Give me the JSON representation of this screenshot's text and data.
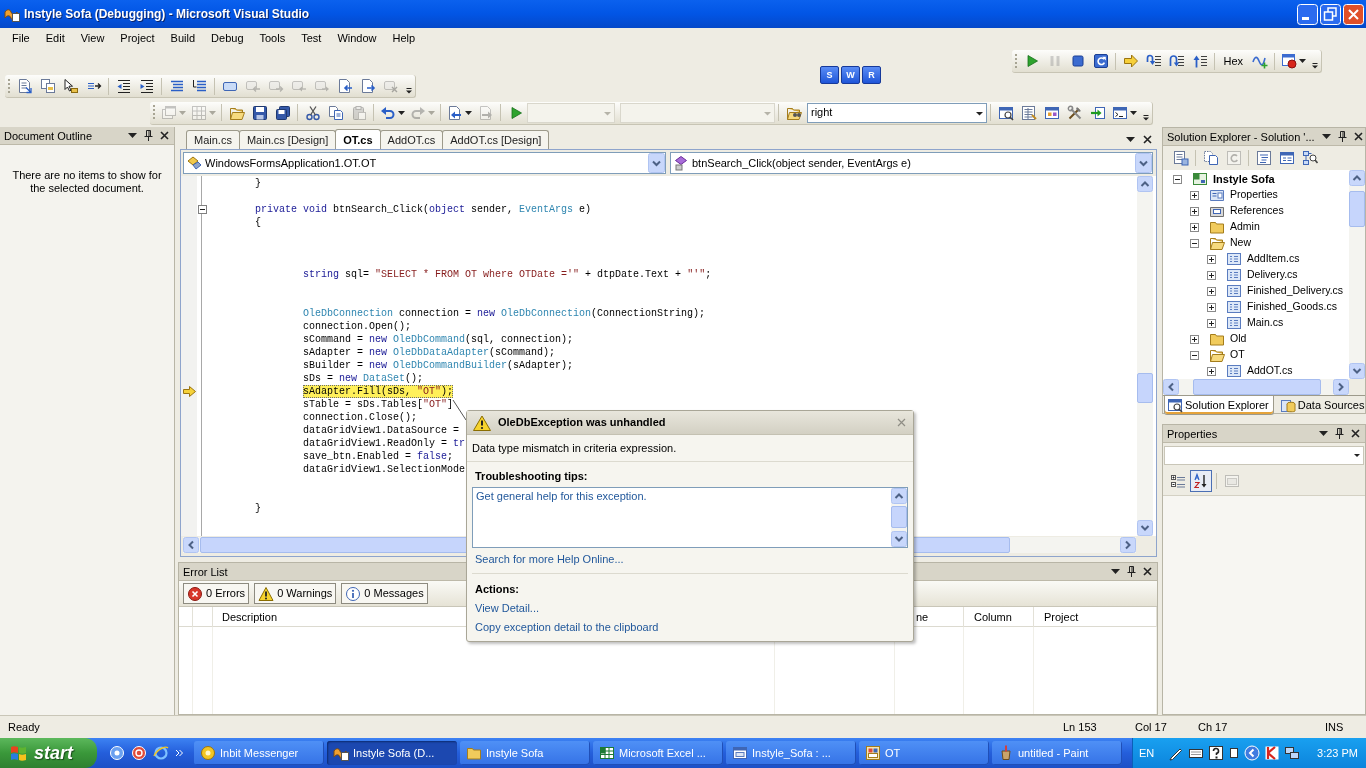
{
  "window": {
    "title": "Instyle Sofa (Debugging) - Microsoft Visual Studio"
  },
  "menu": [
    "File",
    "Edit",
    "View",
    "Project",
    "Build",
    "Debug",
    "Tools",
    "Test",
    "Window",
    "Help"
  ],
  "toolbars": {
    "debug": [
      {
        "kind": "button",
        "disabled": false
      },
      {
        "kind": "button",
        "disabled": true
      },
      {
        "kind": "button",
        "disabled": false
      },
      {
        "kind": "button",
        "disabled": false
      },
      {
        "kind": "button",
        "disabled": false
      },
      {
        "kind": "button",
        "disabled": false
      },
      {
        "kind": "button",
        "disabled": false
      },
      {
        "kind": "button",
        "disabled": false
      },
      {
        "kind": "text",
        "label": "Hex",
        "disabled": false
      },
      {
        "kind": "button",
        "disabled": false
      },
      {
        "kind": "split",
        "disabled": false
      }
    ],
    "text_editor": [
      {
        "kind": "button",
        "disabled": false
      },
      {
        "kind": "button",
        "disabled": false
      },
      {
        "kind": "button",
        "disabled": false
      },
      {
        "kind": "button",
        "disabled": false
      },
      {
        "kind": "button",
        "disabled": false
      },
      {
        "kind": "button",
        "disabled": false
      },
      {
        "kind": "button",
        "disabled": false
      },
      {
        "kind": "button",
        "disabled": false
      },
      {
        "kind": "button",
        "disabled": false
      },
      {
        "kind": "button",
        "disabled": true
      },
      {
        "kind": "button",
        "disabled": true
      },
      {
        "kind": "button",
        "disabled": true
      },
      {
        "kind": "button",
        "disabled": true
      },
      {
        "kind": "button",
        "disabled": false
      },
      {
        "kind": "button",
        "disabled": false
      },
      {
        "kind": "button",
        "disabled": true
      }
    ],
    "standard": [
      {
        "kind": "split",
        "disabled": true
      },
      {
        "kind": "split",
        "disabled": true
      },
      {
        "kind": "button",
        "disabled": false
      },
      {
        "kind": "button",
        "disabled": false
      },
      {
        "kind": "button",
        "disabled": false
      },
      {
        "kind": "button",
        "disabled": false
      },
      {
        "kind": "button",
        "disabled": false
      },
      {
        "kind": "button",
        "disabled": true
      },
      {
        "kind": "split",
        "disabled": false
      },
      {
        "kind": "split",
        "disabled": true
      },
      {
        "kind": "split",
        "disabled": false
      },
      {
        "kind": "button",
        "disabled": true
      },
      {
        "kind": "button",
        "disabled": false
      },
      {
        "kind": "combo",
        "disabled": true
      },
      {
        "kind": "combo",
        "disabled": true
      },
      {
        "kind": "button",
        "disabled": false
      },
      {
        "kind": "combo",
        "value": "right",
        "disabled": false
      },
      {
        "kind": "button",
        "disabled": false
      },
      {
        "kind": "button",
        "disabled": false
      },
      {
        "kind": "button",
        "disabled": false
      },
      {
        "kind": "button",
        "disabled": false
      },
      {
        "kind": "button",
        "disabled": false
      },
      {
        "kind": "split",
        "disabled": false
      }
    ]
  },
  "floating_toolbar": [
    "S",
    "W",
    "R"
  ],
  "document_outline": {
    "title": "Document Outline",
    "message": "There are no items to show for the selected document."
  },
  "editor": {
    "tabs": [
      {
        "label": "Main.cs",
        "selected": false
      },
      {
        "label": "Main.cs [Design]",
        "selected": false
      },
      {
        "label": "OT.cs",
        "selected": true
      },
      {
        "label": "AddOT.cs",
        "selected": false
      },
      {
        "label": "AddOT.cs [Design]",
        "selected": false
      }
    ],
    "type_combo": "WindowsFormsApplication1.OT.OT",
    "member_combo": "btnSearch_Click(object sender, EventArgs e)",
    "lines": [
      {
        "kind": "code",
        "current": false,
        "tokens": [
          {
            "kind": "plain",
            "text": "        }"
          }
        ]
      },
      {
        "kind": "blank"
      },
      {
        "kind": "header",
        "current": false,
        "tokens": [
          {
            "kind": "keyword",
            "text": "        private void"
          },
          {
            "kind": "plain",
            "text": " btnSearch_Click("
          },
          {
            "kind": "keyword",
            "text": "object"
          },
          {
            "kind": "plain",
            "text": " sender, "
          },
          {
            "kind": "type",
            "text": "EventArgs"
          },
          {
            "kind": "plain",
            "text": " e)"
          }
        ]
      },
      {
        "kind": "code",
        "current": false,
        "tokens": [
          {
            "kind": "plain",
            "text": "        {"
          }
        ]
      },
      {
        "kind": "blank"
      },
      {
        "kind": "blank"
      },
      {
        "kind": "blank"
      },
      {
        "kind": "code",
        "current": false,
        "tokens": [
          {
            "kind": "keyword",
            "text": "                string"
          },
          {
            "kind": "plain",
            "text": " sql= "
          },
          {
            "kind": "string",
            "text": "\"SELECT * FROM OT where OTDate ='\""
          },
          {
            "kind": "plain",
            "text": " + dtpDate.Text + "
          },
          {
            "kind": "string",
            "text": "\"'\""
          },
          {
            "kind": "plain",
            "text": ";"
          }
        ]
      },
      {
        "kind": "blank"
      },
      {
        "kind": "blank"
      },
      {
        "kind": "code",
        "current": false,
        "tokens": [
          {
            "kind": "type",
            "text": "                OleDbConnection"
          },
          {
            "kind": "plain",
            "text": " connection = "
          },
          {
            "kind": "keyword",
            "text": "new"
          },
          {
            "kind": "type",
            "text": " OleDbConnection"
          },
          {
            "kind": "plain",
            "text": "(ConnectionString);"
          }
        ]
      },
      {
        "kind": "code",
        "current": false,
        "tokens": [
          {
            "kind": "plain",
            "text": "                connection.Open();"
          }
        ]
      },
      {
        "kind": "code",
        "current": false,
        "tokens": [
          {
            "kind": "plain",
            "text": "                sCommand = "
          },
          {
            "kind": "keyword",
            "text": "new"
          },
          {
            "kind": "type",
            "text": " OleDbCommand"
          },
          {
            "kind": "plain",
            "text": "(sql, connection);"
          }
        ]
      },
      {
        "kind": "code",
        "current": false,
        "tokens": [
          {
            "kind": "plain",
            "text": "                sAdapter = "
          },
          {
            "kind": "keyword",
            "text": "new"
          },
          {
            "kind": "type",
            "text": " OleDbDataAdapter"
          },
          {
            "kind": "plain",
            "text": "(sCommand);"
          }
        ]
      },
      {
        "kind": "code",
        "current": false,
        "tokens": [
          {
            "kind": "plain",
            "text": "                sBuilder = "
          },
          {
            "kind": "keyword",
            "text": "new"
          },
          {
            "kind": "type",
            "text": " OleDbCommandBuilder"
          },
          {
            "kind": "plain",
            "text": "(sAdapter);"
          }
        ]
      },
      {
        "kind": "code",
        "current": false,
        "tokens": [
          {
            "kind": "plain",
            "text": "                sDs = "
          },
          {
            "kind": "keyword",
            "text": "new"
          },
          {
            "kind": "type",
            "text": " DataSet"
          },
          {
            "kind": "plain",
            "text": "();"
          }
        ]
      },
      {
        "kind": "code",
        "current": true,
        "tokens": [
          {
            "kind": "plain",
            "text": "                sAdapter.Fill(sDs, "
          },
          {
            "kind": "string",
            "text": "\"OT\""
          },
          {
            "kind": "plain",
            "text": ");"
          }
        ]
      },
      {
        "kind": "code",
        "current": false,
        "tokens": [
          {
            "kind": "plain",
            "text": "                sTable = sDs.Tables["
          },
          {
            "kind": "string",
            "text": "\"OT\""
          },
          {
            "kind": "plain",
            "text": "]"
          }
        ]
      },
      {
        "kind": "code",
        "current": false,
        "tokens": [
          {
            "kind": "plain",
            "text": "                connection.Close();"
          }
        ]
      },
      {
        "kind": "code",
        "current": false,
        "tokens": [
          {
            "kind": "plain",
            "text": "                dataGridView1.DataSource ="
          }
        ]
      },
      {
        "kind": "code",
        "current": false,
        "tokens": [
          {
            "kind": "plain",
            "text": "                dataGridView1.ReadOnly = "
          },
          {
            "kind": "keyword",
            "text": "tr"
          }
        ]
      },
      {
        "kind": "code",
        "current": false,
        "tokens": [
          {
            "kind": "plain",
            "text": "                save_btn.Enabled = "
          },
          {
            "kind": "keyword",
            "text": "false"
          },
          {
            "kind": "plain",
            "text": ";"
          }
        ]
      },
      {
        "kind": "code",
        "current": false,
        "tokens": [
          {
            "kind": "plain",
            "text": "                dataGridView1.SelectionMode"
          }
        ]
      },
      {
        "kind": "blank"
      },
      {
        "kind": "blank"
      },
      {
        "kind": "code",
        "current": false,
        "tokens": [
          {
            "kind": "plain",
            "text": "        }"
          }
        ]
      }
    ]
  },
  "exception_assistant": {
    "title": "OleDbException was unhandled",
    "message": "Data type mismatch in criteria expression.",
    "tips_heading": "Troubleshooting tips:",
    "tips": [
      "Get general help for this exception."
    ],
    "help_link": "Search for more Help Online...",
    "actions_heading": "Actions:",
    "actions": [
      "View Detail...",
      "Copy exception detail to the clipboard"
    ]
  },
  "error_list": {
    "title": "Error List",
    "filters": [
      {
        "kind": "error",
        "label": "0 Errors",
        "selected": true
      },
      {
        "kind": "warning",
        "label": "0 Warnings",
        "selected": true
      },
      {
        "kind": "message",
        "label": "0 Messages",
        "selected": true
      }
    ],
    "columns": [
      "Description",
      "ne",
      "Column",
      "Project"
    ]
  },
  "solution_explorer": {
    "title": "Solution Explorer - Solution '...",
    "toolbar": [
      {
        "disabled": false
      },
      {
        "disabled": false
      },
      {
        "disabled": true
      },
      {
        "disabled": false
      },
      {
        "disabled": false
      },
      {
        "disabled": false
      }
    ],
    "tree": [
      {
        "label": "Instyle Sofa",
        "kind": "project",
        "expanded": true,
        "children": [
          {
            "label": "Properties",
            "kind": "properties",
            "expanded": false
          },
          {
            "label": "References",
            "kind": "references",
            "expanded": false
          },
          {
            "label": "Admin",
            "kind": "folder",
            "expanded": false
          },
          {
            "label": "New",
            "kind": "folder",
            "expanded": true,
            "children": [
              {
                "label": "AddItem.cs",
                "kind": "file",
                "expanded": false
              },
              {
                "label": "Delivery.cs",
                "kind": "file",
                "expanded": false
              },
              {
                "label": "Finished_Delivery.cs",
                "kind": "file",
                "expanded": false
              },
              {
                "label": "Finished_Goods.cs",
                "kind": "file",
                "expanded": false
              },
              {
                "label": "Main.cs",
                "kind": "file",
                "expanded": false
              }
            ]
          },
          {
            "label": "Old",
            "kind": "folder",
            "expanded": false
          },
          {
            "label": "OT",
            "kind": "folder",
            "expanded": true,
            "children": [
              {
                "label": "AddOT.cs",
                "kind": "file",
                "expanded": false
              }
            ]
          }
        ]
      }
    ],
    "tabs": [
      {
        "label": "Solution Explorer",
        "selected": true
      },
      {
        "label": "Data Sources",
        "selected": false
      }
    ]
  },
  "properties": {
    "title": "Properties",
    "toolbar": [
      {
        "selected": false,
        "disabled": false
      },
      {
        "selected": true,
        "disabled": false
      },
      {
        "selected": false,
        "disabled": true
      }
    ]
  },
  "status_bar": {
    "message": "Ready",
    "line": "Ln 153",
    "column": "Col 17",
    "char": "Ch 17",
    "mode": "INS"
  },
  "taskbar": {
    "start": "start",
    "tasks": [
      {
        "label": "Inbit Messenger",
        "selected": false
      },
      {
        "label": "Instyle Sofa (D...",
        "selected": true
      },
      {
        "label": "Instyle Sofa",
        "selected": false
      },
      {
        "label": "Microsoft Excel ...",
        "selected": false
      },
      {
        "label": "Instyle_Sofa : ...",
        "selected": false
      },
      {
        "label": "OT",
        "selected": false
      },
      {
        "label": "untitled - Paint",
        "selected": false
      }
    ],
    "language": "EN",
    "clock": "3:23 PM"
  }
}
